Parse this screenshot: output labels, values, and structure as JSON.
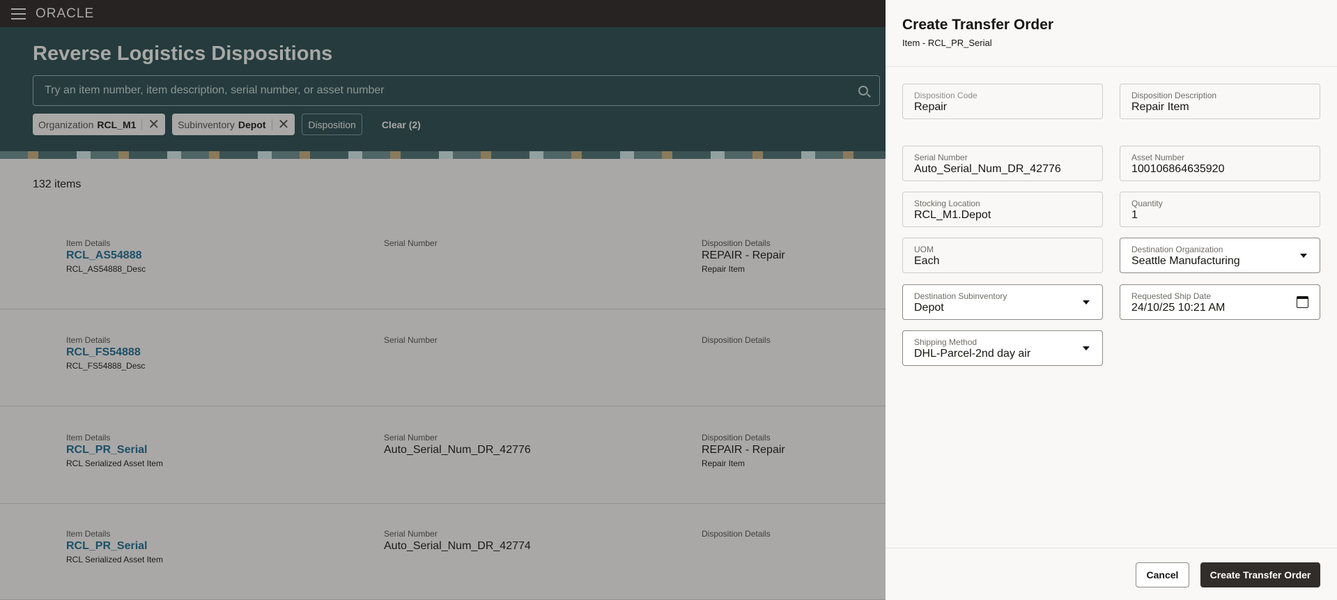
{
  "app": {
    "logo": "ORACLE",
    "title": "Reverse Logistics Dispositions"
  },
  "search": {
    "placeholder": "Try an item number, item description, serial number, or asset number"
  },
  "filters": [
    {
      "label": "Organization",
      "value": "RCL_M1"
    },
    {
      "label": "Subinventory",
      "value": "Depot"
    }
  ],
  "filter_disposition": "Disposition",
  "clear_label": "Clear (2)",
  "count": "132 items",
  "labels": {
    "item": "Item Details",
    "serial": "Serial Number",
    "disp": "Disposition Details"
  },
  "rows": [
    {
      "item": "RCL_AS54888",
      "desc": "RCL_AS54888_Desc",
      "serial": "",
      "disp": "REPAIR - Repair",
      "disp_desc": "Repair Item"
    },
    {
      "item": "RCL_FS54888",
      "desc": "RCL_FS54888_Desc",
      "serial": "",
      "disp": "",
      "disp_desc": ""
    },
    {
      "item": "RCL_PR_Serial",
      "desc": "RCL Serialized Asset Item",
      "serial": "Auto_Serial_Num_DR_42776",
      "disp": "REPAIR - Repair",
      "disp_desc": "Repair Item"
    },
    {
      "item": "RCL_PR_Serial",
      "desc": "RCL Serialized Asset Item",
      "serial": "Auto_Serial_Num_DR_42774",
      "disp": "",
      "disp_desc": ""
    }
  ],
  "panel": {
    "title": "Create Transfer Order",
    "subtitle": "Item - RCL_PR_Serial",
    "fields": [
      {
        "label": "Disposition Code",
        "value": "Repair"
      },
      {
        "label": "Disposition Description",
        "value": "Repair Item"
      },
      {
        "label": "Serial Number",
        "value": "Auto_Serial_Num_DR_42776"
      },
      {
        "label": "Asset Number",
        "value": "100106864635920"
      },
      {
        "label": "Stocking Location",
        "value": "RCL_M1.Depot"
      },
      {
        "label": "Quantity",
        "value": "1"
      },
      {
        "label": "UOM",
        "value": "Each"
      },
      {
        "label": "Destination Organization",
        "value": "Seattle Manufacturing"
      },
      {
        "label": "Destination Subinventory",
        "value": "Depot"
      },
      {
        "label": "Requested Ship Date",
        "value": "24/10/25 10:21 AM"
      },
      {
        "label": "Shipping Method",
        "value": "DHL-Parcel-2nd day air"
      }
    ],
    "cancel": "Cancel",
    "create": "Create Transfer Order"
  }
}
